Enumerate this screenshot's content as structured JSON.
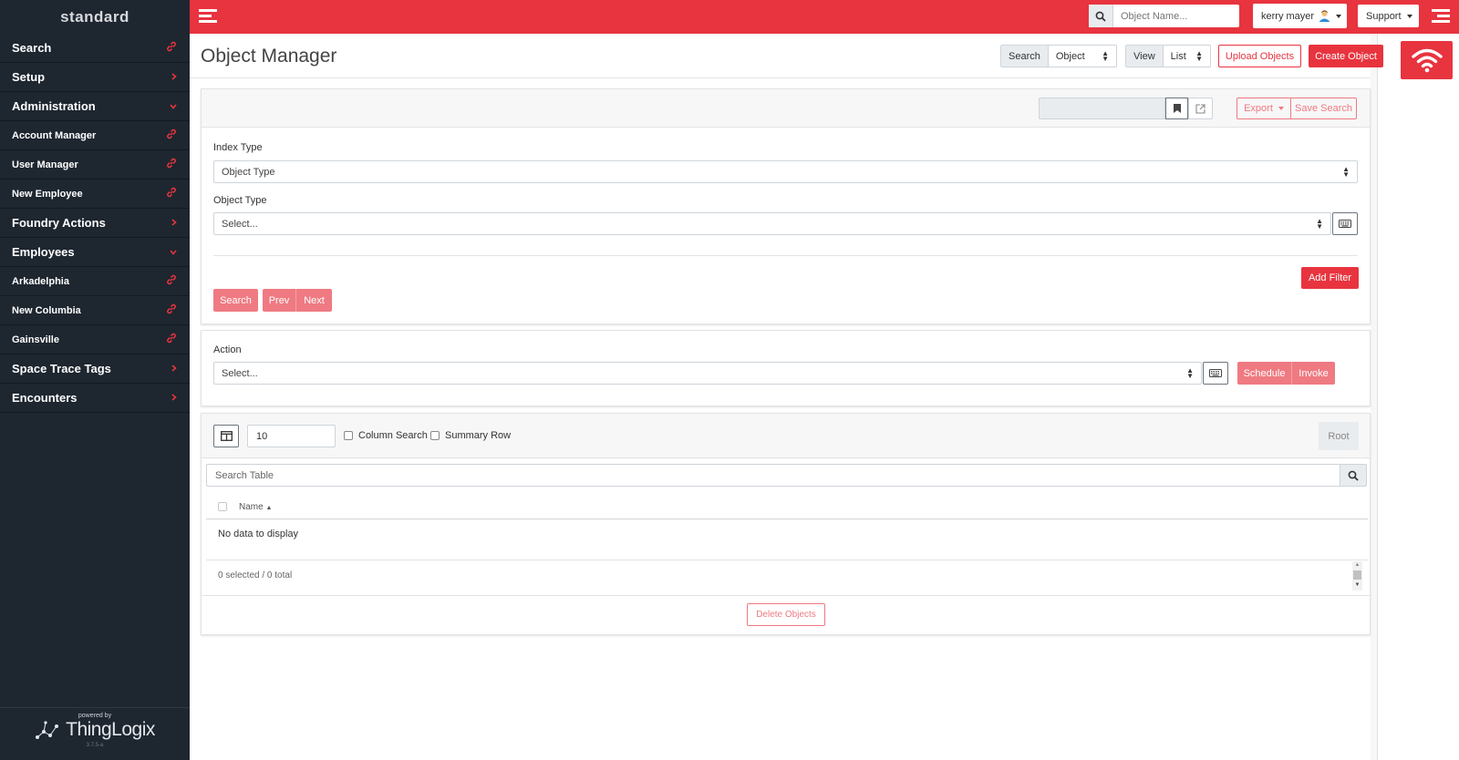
{
  "sidebar": {
    "brand": "standard",
    "items": [
      {
        "label": "Search",
        "type": "top",
        "icon": "link-icon"
      },
      {
        "label": "Setup",
        "type": "top",
        "icon": "chevron-right-icon"
      },
      {
        "label": "Administration",
        "type": "top",
        "icon": "chevron-down-icon"
      },
      {
        "label": "Account Manager",
        "type": "sub",
        "icon": "link-icon"
      },
      {
        "label": "User Manager",
        "type": "sub",
        "icon": "link-icon"
      },
      {
        "label": "New Employee",
        "type": "sub",
        "icon": "link-icon"
      },
      {
        "label": "Foundry Actions",
        "type": "top",
        "icon": "chevron-right-icon"
      },
      {
        "label": "Employees",
        "type": "top",
        "icon": "chevron-down-icon"
      },
      {
        "label": "Arkadelphia",
        "type": "sub",
        "icon": "link-icon"
      },
      {
        "label": "New Columbia",
        "type": "sub",
        "icon": "link-icon"
      },
      {
        "label": "Gainsville",
        "type": "sub",
        "icon": "link-icon"
      },
      {
        "label": "Space Trace Tags",
        "type": "top",
        "icon": "chevron-right-icon"
      },
      {
        "label": "Encounters",
        "type": "top",
        "icon": "chevron-right-icon"
      }
    ],
    "powered_by": "powered by",
    "company": "ThingLogix",
    "version": "3.7.5-a"
  },
  "topbar": {
    "search_placeholder": "Object Name...",
    "user": "kerry mayer",
    "support": "Support"
  },
  "header": {
    "title": "Object Manager",
    "search_label": "Search",
    "search_value": "Object",
    "view_label": "View",
    "view_value": "List",
    "upload_label": "Upload Objects",
    "create_label": "Create Object"
  },
  "filter_card": {
    "export_label": "Export",
    "save_search_label": "Save Search",
    "index_type_label": "Index Type",
    "index_type_value": "Object Type",
    "object_type_label": "Object Type",
    "object_type_value": "Select...",
    "add_filter_label": "Add Filter",
    "search_label": "Search",
    "prev_label": "Prev",
    "next_label": "Next"
  },
  "action_card": {
    "action_label": "Action",
    "action_value": "Select...",
    "schedule_label": "Schedule",
    "invoke_label": "Invoke"
  },
  "table_card": {
    "page_size": "10",
    "column_search_label": "Column Search",
    "summary_row_label": "Summary Row",
    "root_label": "Root",
    "search_placeholder": "Search Table",
    "column_name": "Name",
    "empty_text": "No data to display",
    "footer_text": "0 selected / 0 total",
    "delete_label": "Delete Objects"
  },
  "colors": {
    "accent": "#e8343f",
    "sidebar_bg": "#1e2630"
  }
}
